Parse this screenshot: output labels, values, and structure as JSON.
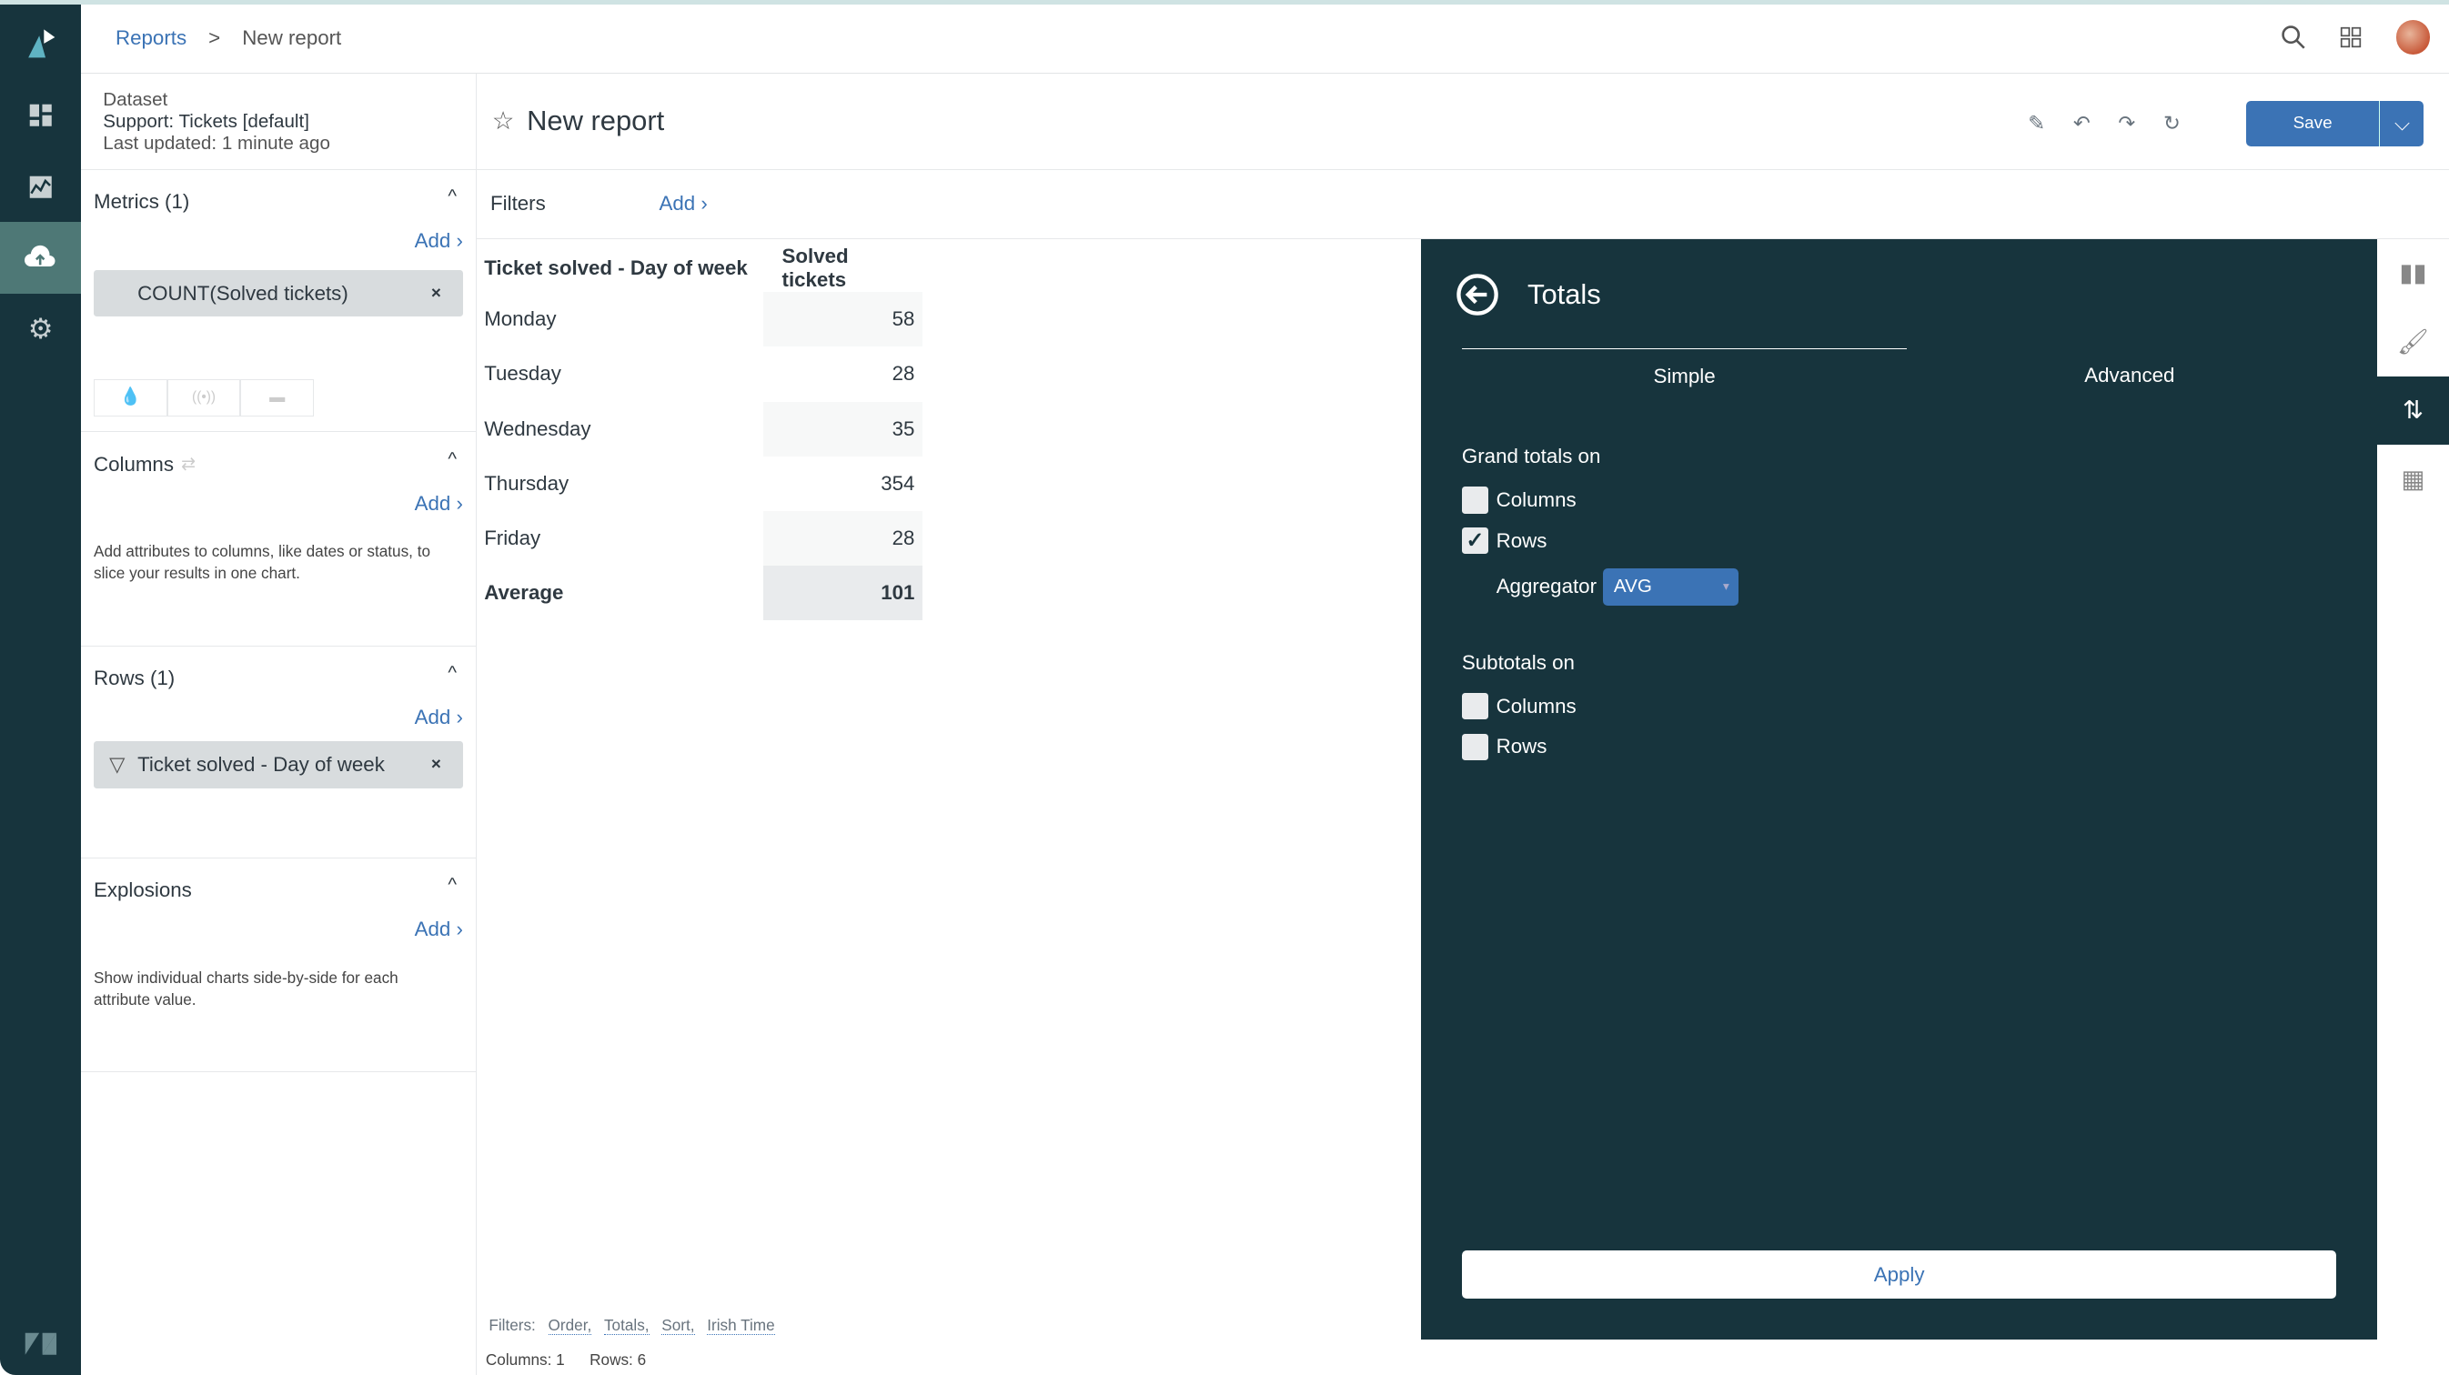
{
  "nav": {
    "items": [
      "logo-icon",
      "dashboard-icon",
      "reports-icon",
      "upload-icon",
      "settings-icon"
    ],
    "footer": "zendesk-logo-icon"
  },
  "breadcrumb": {
    "parent": "Reports",
    "separator": ">",
    "current": "New report"
  },
  "dataset": {
    "label": "Dataset",
    "name": "Support: Tickets [default]",
    "updated": "Last updated: 1 minute ago"
  },
  "metrics": {
    "title": "Metrics (1)",
    "add": "Add ›",
    "pill": "COUNT(Solved tickets)",
    "remove": "×"
  },
  "columns": {
    "title": "Columns",
    "add": "Add ›",
    "hint": "Add attributes to columns, like dates or status, to slice your results in one chart."
  },
  "rows": {
    "title": "Rows (1)",
    "add": "Add ›",
    "pill": "Ticket solved - Day of week",
    "remove": "×"
  },
  "explosions": {
    "title": "Explosions",
    "add": "Add ›",
    "hint": "Show individual charts side-by-side for each attribute value."
  },
  "report": {
    "title": "New report",
    "save": "Save"
  },
  "filters": {
    "label": "Filters",
    "add": "Add ›"
  },
  "table": {
    "headers": [
      "Ticket solved - Day of week",
      "Solved tickets"
    ],
    "rows": [
      [
        "Monday",
        "58"
      ],
      [
        "Tuesday",
        "28"
      ],
      [
        "Wednesday",
        "35"
      ],
      [
        "Thursday",
        "354"
      ],
      [
        "Friday",
        "28"
      ]
    ],
    "total": [
      "Average",
      "101"
    ]
  },
  "footer": {
    "filters_label": "Filters:",
    "filters": [
      "Order,",
      "Totals,",
      "Sort,",
      "Irish Time"
    ],
    "columns": "Columns: 1",
    "rows": "Rows: 6"
  },
  "totals": {
    "title": "Totals",
    "tabs": [
      "Simple",
      "Advanced"
    ],
    "active_tab": "Simple",
    "grand_label": "Grand totals on",
    "grand_columns": "Columns",
    "grand_columns_checked": false,
    "grand_rows": "Rows",
    "grand_rows_checked": true,
    "aggregator_label": "Aggregator",
    "aggregator": "AVG",
    "sub_label": "Subtotals on",
    "sub_columns": "Columns",
    "sub_columns_checked": false,
    "sub_rows": "Rows",
    "sub_rows_checked": false,
    "apply": "Apply"
  },
  "colors": {
    "sidebar": "#17343d",
    "accent": "#3b73b5"
  }
}
